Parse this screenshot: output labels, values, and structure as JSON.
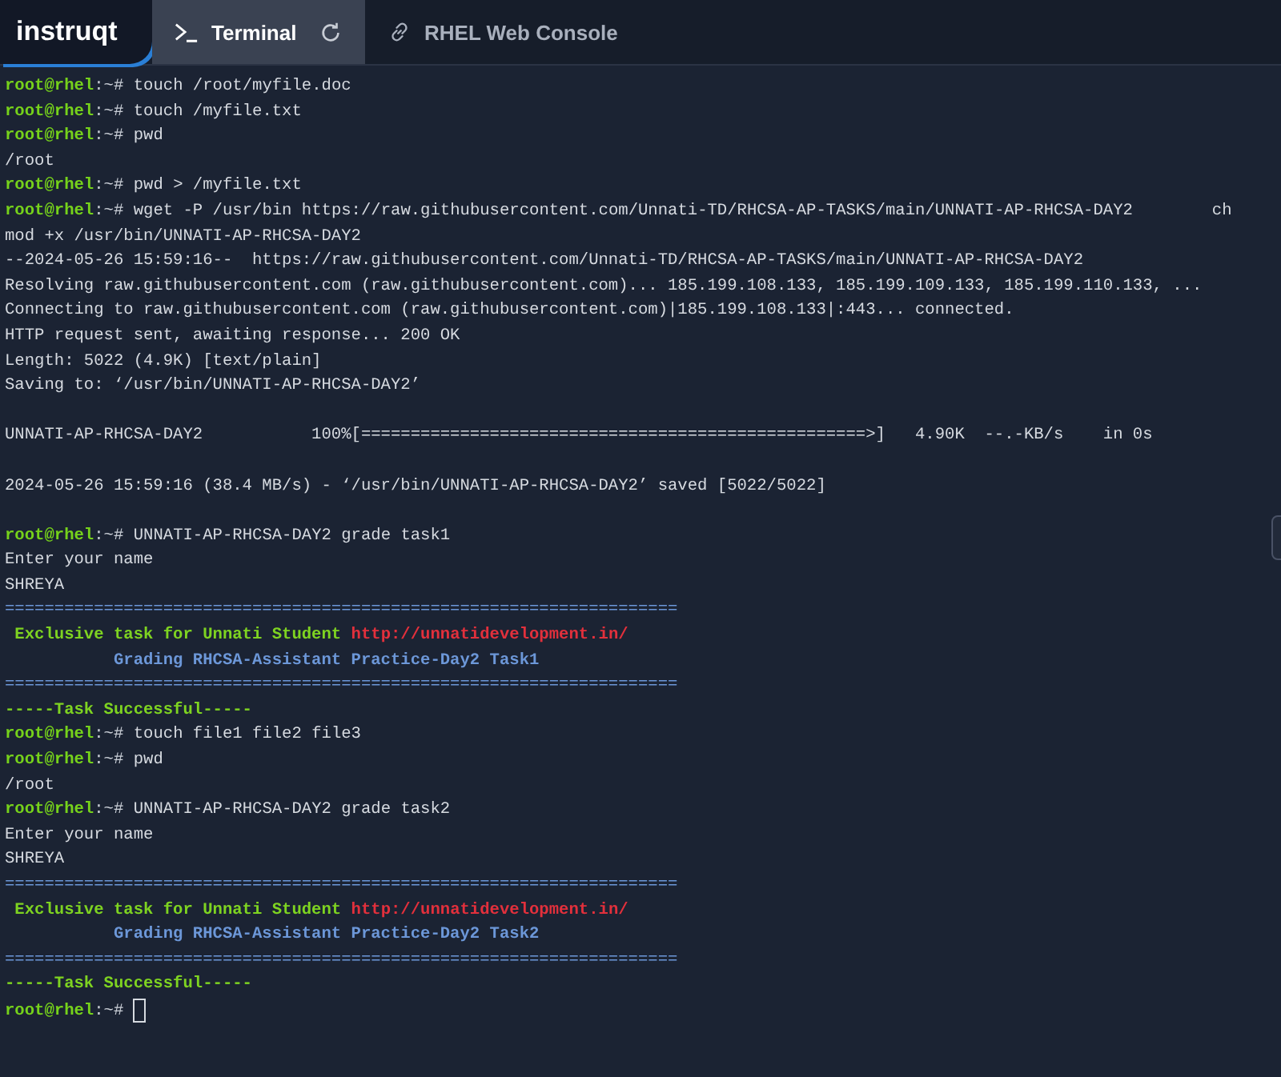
{
  "header": {
    "logo": "instruqt",
    "tabs": [
      {
        "label": "Terminal",
        "kind": "terminal",
        "selected": true
      },
      {
        "label": "RHEL Web Console",
        "kind": "link",
        "selected": false
      }
    ]
  },
  "terminal": {
    "lines": [
      {
        "kind": "prompt",
        "user": "root@rhel",
        "sep": ":~#",
        "command": "touch /root/myfile.doc"
      },
      {
        "kind": "prompt",
        "user": "root@rhel",
        "sep": ":~#",
        "command": "touch /myfile.txt"
      },
      {
        "kind": "prompt",
        "user": "root@rhel",
        "sep": ":~#",
        "command": "pwd"
      },
      {
        "kind": "output",
        "text": "/root"
      },
      {
        "kind": "prompt",
        "user": "root@rhel",
        "sep": ":~#",
        "command": "pwd > /myfile.txt"
      },
      {
        "kind": "prompt",
        "user": "root@rhel",
        "sep": ":~#",
        "command": "wget -P /usr/bin https://raw.githubusercontent.com/Unnati-TD/RHCSA-AP-TASKS/main/UNNATI-AP-RHCSA-DAY2        ch"
      },
      {
        "kind": "output",
        "text": "mod +x /usr/bin/UNNATI-AP-RHCSA-DAY2"
      },
      {
        "kind": "output",
        "text": "--2024-05-26 15:59:16--  https://raw.githubusercontent.com/Unnati-TD/RHCSA-AP-TASKS/main/UNNATI-AP-RHCSA-DAY2"
      },
      {
        "kind": "output",
        "text": "Resolving raw.githubusercontent.com (raw.githubusercontent.com)... 185.199.108.133, 185.199.109.133, 185.199.110.133, ..."
      },
      {
        "kind": "output",
        "text": "Connecting to raw.githubusercontent.com (raw.githubusercontent.com)|185.199.108.133|:443... connected."
      },
      {
        "kind": "output",
        "text": "HTTP request sent, awaiting response... 200 OK"
      },
      {
        "kind": "output",
        "text": "Length: 5022 (4.9K) [text/plain]"
      },
      {
        "kind": "output",
        "text": "Saving to: ‘/usr/bin/UNNATI-AP-RHCSA-DAY2’"
      },
      {
        "kind": "blank"
      },
      {
        "kind": "output",
        "text": "UNNATI-AP-RHCSA-DAY2           100%[===================================================>]   4.90K  --.-KB/s    in 0s"
      },
      {
        "kind": "blank"
      },
      {
        "kind": "output",
        "text": "2024-05-26 15:59:16 (38.4 MB/s) - ‘/usr/bin/UNNATI-AP-RHCSA-DAY2’ saved [5022/5022]"
      },
      {
        "kind": "blank"
      },
      {
        "kind": "prompt",
        "user": "root@rhel",
        "sep": ":~#",
        "command": "UNNATI-AP-RHCSA-DAY2 grade task1"
      },
      {
        "kind": "output",
        "text": "Enter your name"
      },
      {
        "kind": "output",
        "text": "SHREYA"
      },
      {
        "kind": "rule",
        "text": "===================================================================="
      },
      {
        "kind": "banner",
        "text": " Exclusive task for Unnati Student",
        "link": "http://unnatidevelopment.in/"
      },
      {
        "kind": "info",
        "text": "           Grading RHCSA-Assistant Practice-Day2 Task1"
      },
      {
        "kind": "rule",
        "text": "===================================================================="
      },
      {
        "kind": "success",
        "text": "-----Task Successful-----"
      },
      {
        "kind": "prompt",
        "user": "root@rhel",
        "sep": ":~#",
        "command": "touch file1 file2 file3"
      },
      {
        "kind": "prompt",
        "user": "root@rhel",
        "sep": ":~#",
        "command": "pwd"
      },
      {
        "kind": "output",
        "text": "/root"
      },
      {
        "kind": "prompt",
        "user": "root@rhel",
        "sep": ":~#",
        "command": "UNNATI-AP-RHCSA-DAY2 grade task2"
      },
      {
        "kind": "output",
        "text": "Enter your name"
      },
      {
        "kind": "output",
        "text": "SHREYA"
      },
      {
        "kind": "rule",
        "text": "===================================================================="
      },
      {
        "kind": "banner",
        "text": " Exclusive task for Unnati Student",
        "link": "http://unnatidevelopment.in/"
      },
      {
        "kind": "info",
        "text": "           Grading RHCSA-Assistant Practice-Day2 Task2"
      },
      {
        "kind": "rule",
        "text": "===================================================================="
      },
      {
        "kind": "success",
        "text": "-----Task Successful-----"
      },
      {
        "kind": "active-prompt",
        "user": "root@rhel",
        "sep": ":~#"
      }
    ]
  }
}
